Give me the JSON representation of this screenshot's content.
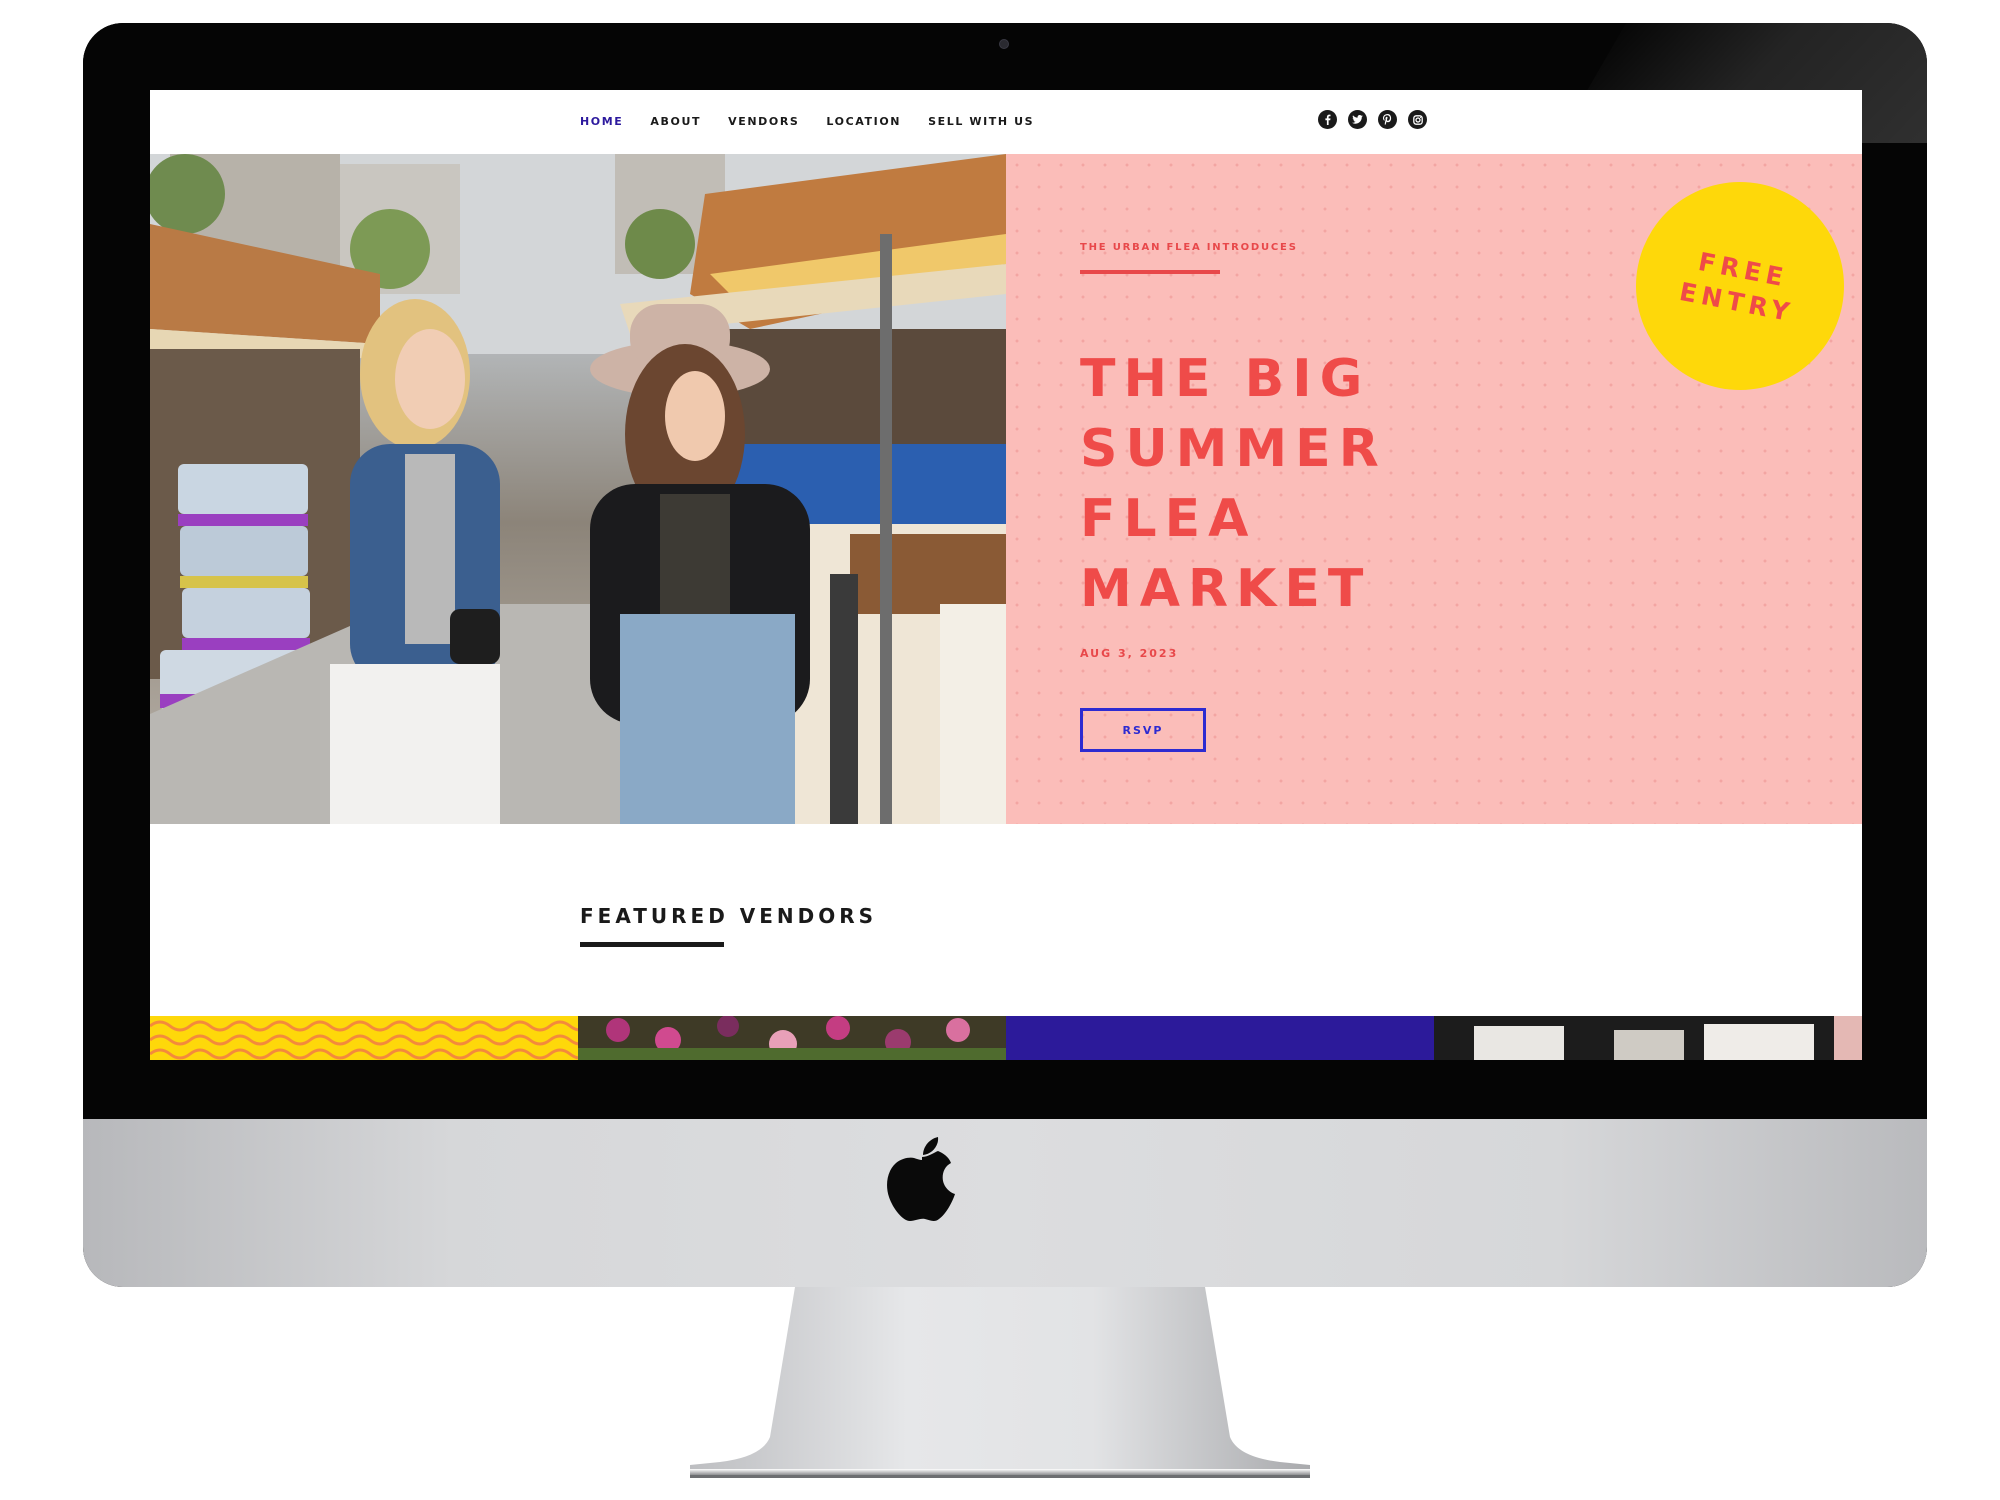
{
  "nav": {
    "items": [
      {
        "label": "HOME",
        "active": true
      },
      {
        "label": "ABOUT",
        "active": false
      },
      {
        "label": "VENDORS",
        "active": false
      },
      {
        "label": "LOCATION",
        "active": false
      },
      {
        "label": "SELL WITH US",
        "active": false
      }
    ],
    "social_icons": [
      "facebook-icon",
      "twitter-icon",
      "pinterest-icon",
      "instagram-icon"
    ]
  },
  "hero": {
    "eyebrow": "THE URBAN FLEA INTRODUCES",
    "title_lines": [
      "THE BIG",
      "SUMMER",
      "FLEA",
      "MARKET"
    ],
    "date": "AUG 3, 2023",
    "rsvp_label": "RSVP",
    "badge_lines": [
      "FREE",
      "ENTRY"
    ]
  },
  "featured": {
    "title": "FEATURED VENDORS"
  },
  "colors": {
    "accent_red": "#ef4b49",
    "panel_pink": "#fbbdb9",
    "badge_yellow": "#fed80a",
    "button_blue": "#2d2bd1",
    "nav_active": "#2d1a9e"
  }
}
